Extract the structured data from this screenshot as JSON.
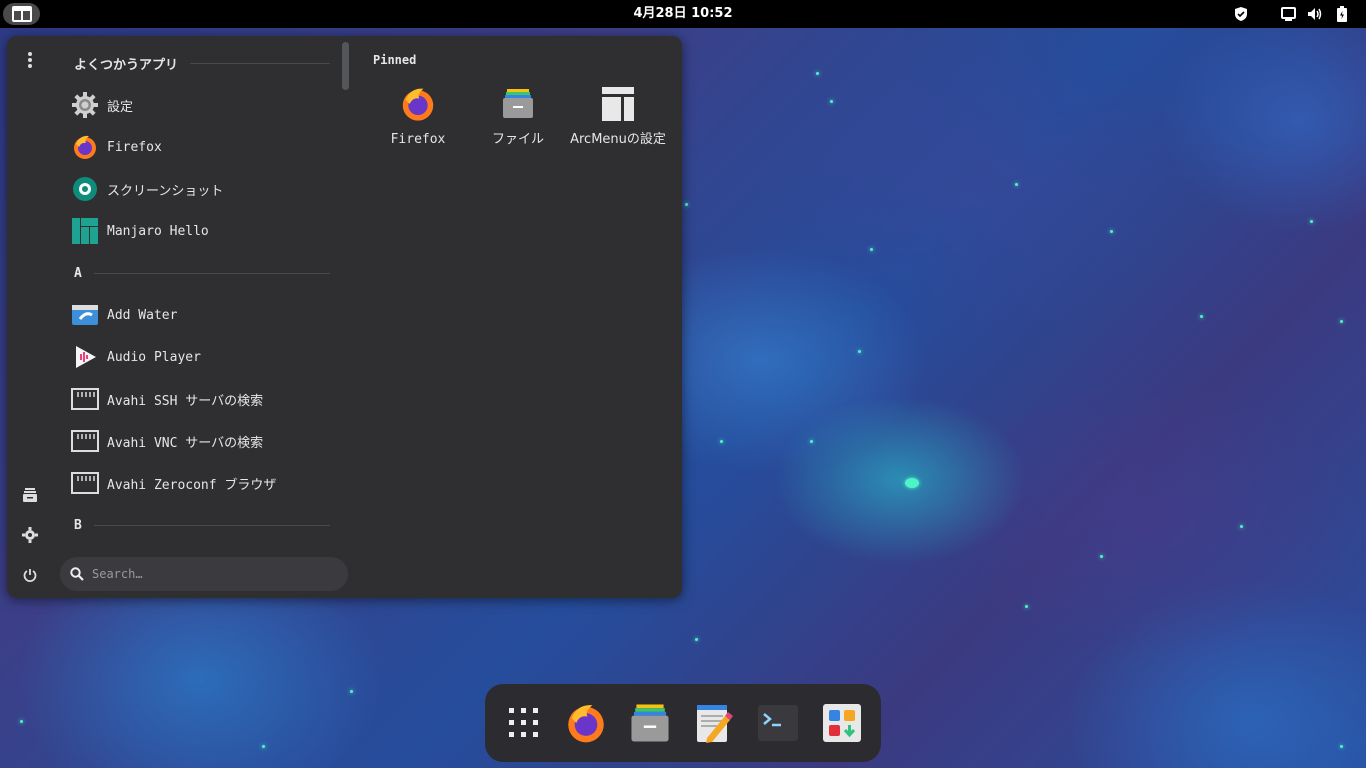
{
  "topbar": {
    "clock": "4月28日 10:52",
    "tray_icons": [
      "shield-icon",
      "screen-icon",
      "volume-icon",
      "battery-icon"
    ]
  },
  "menu": {
    "frequent_header": "よくつかうアプリ",
    "frequent_apps": [
      {
        "label": "設定",
        "icon": "settings-gear-icon"
      },
      {
        "label": "Firefox",
        "icon": "firefox-icon"
      },
      {
        "label": "スクリーンショット",
        "icon": "screenshot-icon"
      },
      {
        "label": "Manjaro Hello",
        "icon": "manjaro-icon"
      }
    ],
    "section_a": "A",
    "a_apps": [
      {
        "label": "Add Water",
        "icon": "add-water-icon"
      },
      {
        "label": "Audio Player",
        "icon": "audio-player-icon"
      },
      {
        "label": "Avahi SSH サーバの検索",
        "icon": "network-icon"
      },
      {
        "label": "Avahi VNC サーバの検索",
        "icon": "network-icon"
      },
      {
        "label": "Avahi Zeroconf ブラウザ",
        "icon": "network-icon"
      }
    ],
    "section_b": "B",
    "pinned_title": "Pinned",
    "pinned": [
      {
        "label": "Firefox",
        "icon": "firefox-icon"
      },
      {
        "label": "ファイル",
        "icon": "files-icon"
      },
      {
        "label": "ArcMenuの設定",
        "icon": "arcmenu-icon"
      }
    ],
    "search_placeholder": "Search…",
    "sidebar_icons": [
      "more-vert-icon",
      "files-icon",
      "settings-icon",
      "power-icon"
    ]
  },
  "dock": {
    "items": [
      "app-grid-icon",
      "firefox-icon",
      "files-icon",
      "text-editor-icon",
      "terminal-icon",
      "software-store-icon"
    ]
  },
  "colors": {
    "panel_bg": "#2f2f32",
    "topbar_bg": "#000000",
    "dock_bg": "#2c2c30",
    "accent_teal": "#4ff3c8"
  }
}
